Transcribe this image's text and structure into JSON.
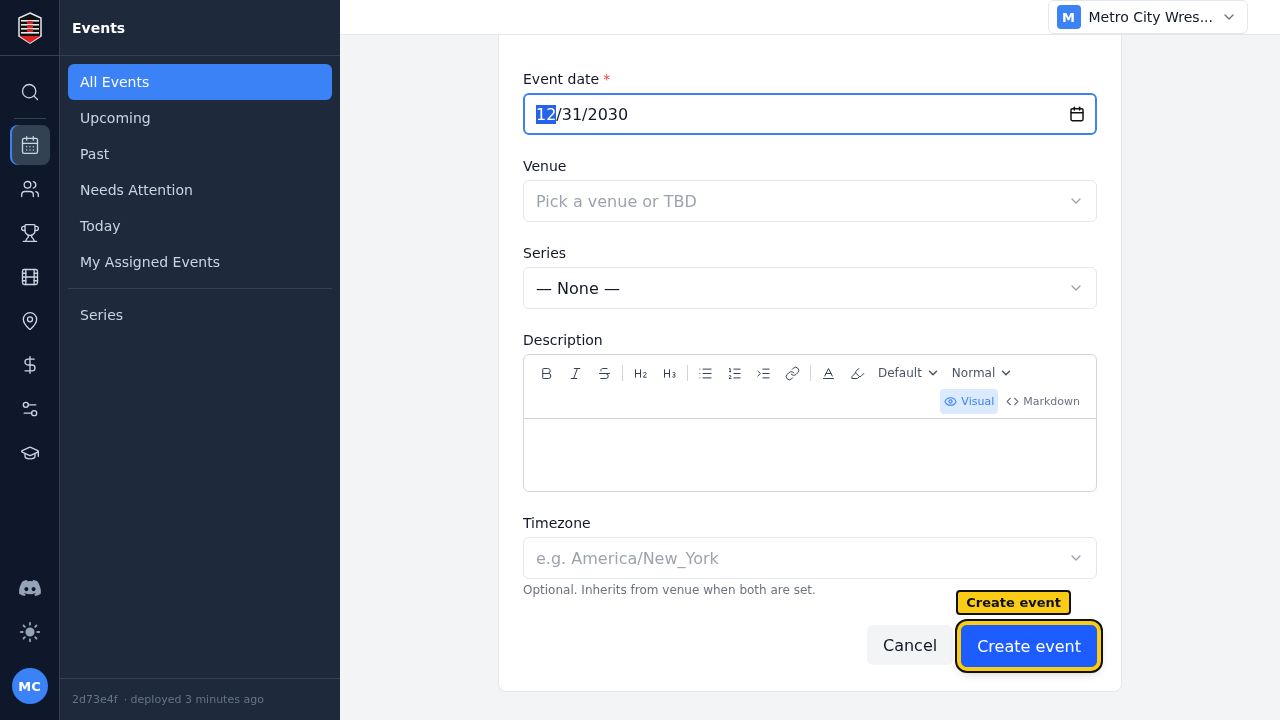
{
  "rail": {
    "items": [
      {
        "kind": "search",
        "selected": false
      },
      {
        "kind": "calendar",
        "selected": true
      },
      {
        "kind": "users",
        "selected": false
      },
      {
        "kind": "trophy",
        "selected": false
      },
      {
        "kind": "film",
        "selected": false
      },
      {
        "kind": "pin",
        "selected": false
      },
      {
        "kind": "dollar",
        "selected": false
      },
      {
        "kind": "sliders",
        "selected": false
      },
      {
        "kind": "cap",
        "selected": false
      }
    ],
    "bottom": [
      {
        "kind": "discord"
      },
      {
        "kind": "sun"
      }
    ],
    "avatar": "MC"
  },
  "sidebar": {
    "title": "Events",
    "items": [
      {
        "label": "All Events",
        "selected": true
      },
      {
        "label": "Upcoming",
        "selected": false
      },
      {
        "label": "Past",
        "selected": false
      },
      {
        "label": "Needs Attention",
        "selected": false
      },
      {
        "label": "Today",
        "selected": false
      },
      {
        "label": "My Assigned Events",
        "selected": false
      }
    ],
    "secondary": [
      {
        "label": "Series",
        "selected": false
      }
    ],
    "footer": {
      "commit": "2d73e4f",
      "deployed": "· deployed 3 minutes ago"
    }
  },
  "org_switcher": {
    "badge": "M",
    "name": "Metro City Wres..."
  },
  "form": {
    "event_date": {
      "label": "Event date",
      "required_mark": "*",
      "separator": "/",
      "segments": [
        {
          "text": "12",
          "selected": true
        },
        {
          "text": "31",
          "selected": false
        },
        {
          "text": "2030",
          "selected": false
        }
      ]
    },
    "venue": {
      "label": "Venue",
      "placeholder": "Pick a venue or TBD"
    },
    "series": {
      "label": "Series",
      "value": "— None —"
    },
    "description": {
      "label": "Description",
      "tools": [
        {
          "kind": "bold"
        },
        {
          "kind": "italic"
        },
        {
          "kind": "strike"
        },
        {
          "kind": "sep"
        },
        {
          "kind": "h2"
        },
        {
          "kind": "h3"
        },
        {
          "kind": "sep"
        },
        {
          "kind": "bullets"
        },
        {
          "kind": "numbers"
        },
        {
          "kind": "indent"
        },
        {
          "kind": "link"
        },
        {
          "kind": "sep"
        },
        {
          "kind": "color"
        },
        {
          "kind": "highlight"
        }
      ],
      "dropdowns": [
        "Default",
        "Normal"
      ],
      "modes": [
        {
          "label": "Visual",
          "kind": "visual",
          "selected": true
        },
        {
          "label": "Markdown",
          "kind": "markdown",
          "selected": false
        }
      ]
    },
    "timezone": {
      "label": "Timezone",
      "placeholder": "e.g. America/New_York",
      "hint": "Optional. Inherits from venue when both are set."
    },
    "cancel": "Cancel",
    "submit": "Create event",
    "highlight_label": "Create event"
  }
}
